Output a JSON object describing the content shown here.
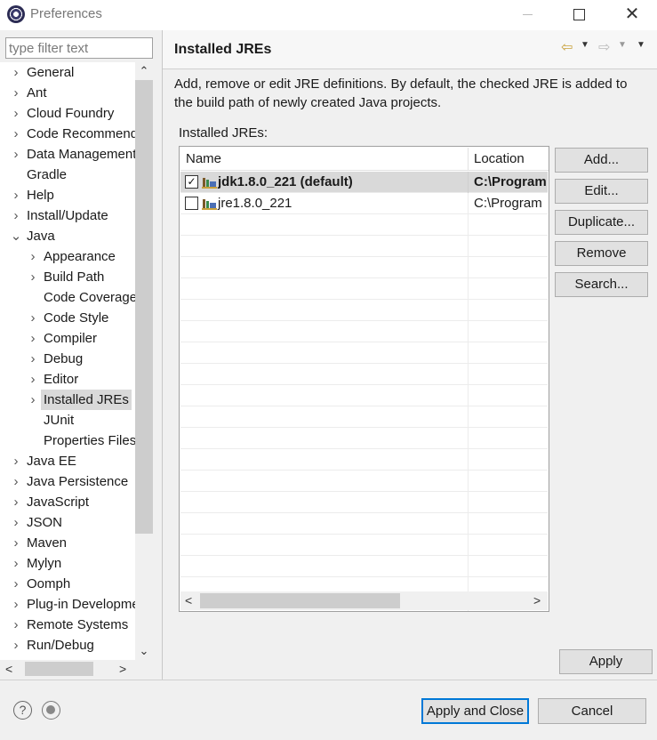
{
  "window": {
    "title": "Preferences"
  },
  "filter": {
    "placeholder": "type filter text"
  },
  "tree": [
    {
      "label": "General",
      "expander": ">",
      "level": 0
    },
    {
      "label": "Ant",
      "expander": ">",
      "level": 0
    },
    {
      "label": "Cloud Foundry",
      "expander": ">",
      "level": 0
    },
    {
      "label": "Code Recommenders",
      "expander": ">",
      "level": 0
    },
    {
      "label": "Data Management",
      "expander": ">",
      "level": 0
    },
    {
      "label": "Gradle",
      "expander": "",
      "level": 0
    },
    {
      "label": "Help",
      "expander": ">",
      "level": 0
    },
    {
      "label": "Install/Update",
      "expander": ">",
      "level": 0
    },
    {
      "label": "Java",
      "expander": "v",
      "level": 0
    },
    {
      "label": "Appearance",
      "expander": ">",
      "level": 1
    },
    {
      "label": "Build Path",
      "expander": ">",
      "level": 1
    },
    {
      "label": "Code Coverage",
      "expander": "",
      "level": 1
    },
    {
      "label": "Code Style",
      "expander": ">",
      "level": 1
    },
    {
      "label": "Compiler",
      "expander": ">",
      "level": 1
    },
    {
      "label": "Debug",
      "expander": ">",
      "level": 1
    },
    {
      "label": "Editor",
      "expander": ">",
      "level": 1
    },
    {
      "label": "Installed JREs",
      "expander": ">",
      "level": 1,
      "selected": true
    },
    {
      "label": "JUnit",
      "expander": "",
      "level": 1
    },
    {
      "label": "Properties Files Editor",
      "expander": "",
      "level": 1
    },
    {
      "label": "Java EE",
      "expander": ">",
      "level": 0
    },
    {
      "label": "Java Persistence",
      "expander": ">",
      "level": 0
    },
    {
      "label": "JavaScript",
      "expander": ">",
      "level": 0
    },
    {
      "label": "JSON",
      "expander": ">",
      "level": 0
    },
    {
      "label": "Maven",
      "expander": ">",
      "level": 0
    },
    {
      "label": "Mylyn",
      "expander": ">",
      "level": 0
    },
    {
      "label": "Oomph",
      "expander": ">",
      "level": 0
    },
    {
      "label": "Plug-in Development",
      "expander": ">",
      "level": 0
    },
    {
      "label": "Remote Systems",
      "expander": ">",
      "level": 0
    },
    {
      "label": "Run/Debug",
      "expander": ">",
      "level": 0
    }
  ],
  "page": {
    "title": "Installed JREs",
    "description": "Add, remove or edit JRE definitions. By default, the checked JRE is added to the build path of newly created Java projects.",
    "table_caption": "Installed JREs:"
  },
  "table": {
    "columns": [
      "Name",
      "Location"
    ],
    "rows": [
      {
        "name": "jdk1.8.0_221 (default)",
        "location": "C:\\Program",
        "checked": true,
        "selected": true
      },
      {
        "name": "jre1.8.0_221",
        "location": "C:\\Program",
        "checked": false,
        "selected": false
      }
    ],
    "empty_rows": 19
  },
  "buttons": {
    "add": "Add...",
    "edit": "Edit...",
    "duplicate": "Duplicate...",
    "remove": "Remove",
    "search": "Search...",
    "apply": "Apply",
    "apply_close": "Apply and Close",
    "cancel": "Cancel"
  },
  "icons": {
    "app": "eclipse-icon",
    "back": "back-arrow-icon",
    "forward": "forward-arrow-icon",
    "menu": "view-menu-icon",
    "help": "help-icon",
    "status": "status-icon",
    "jre": "jre-library-icon"
  },
  "colors": {
    "accent": "#0078d7",
    "selection": "#d9d9d9",
    "back_arrow": "#c8a13b"
  }
}
